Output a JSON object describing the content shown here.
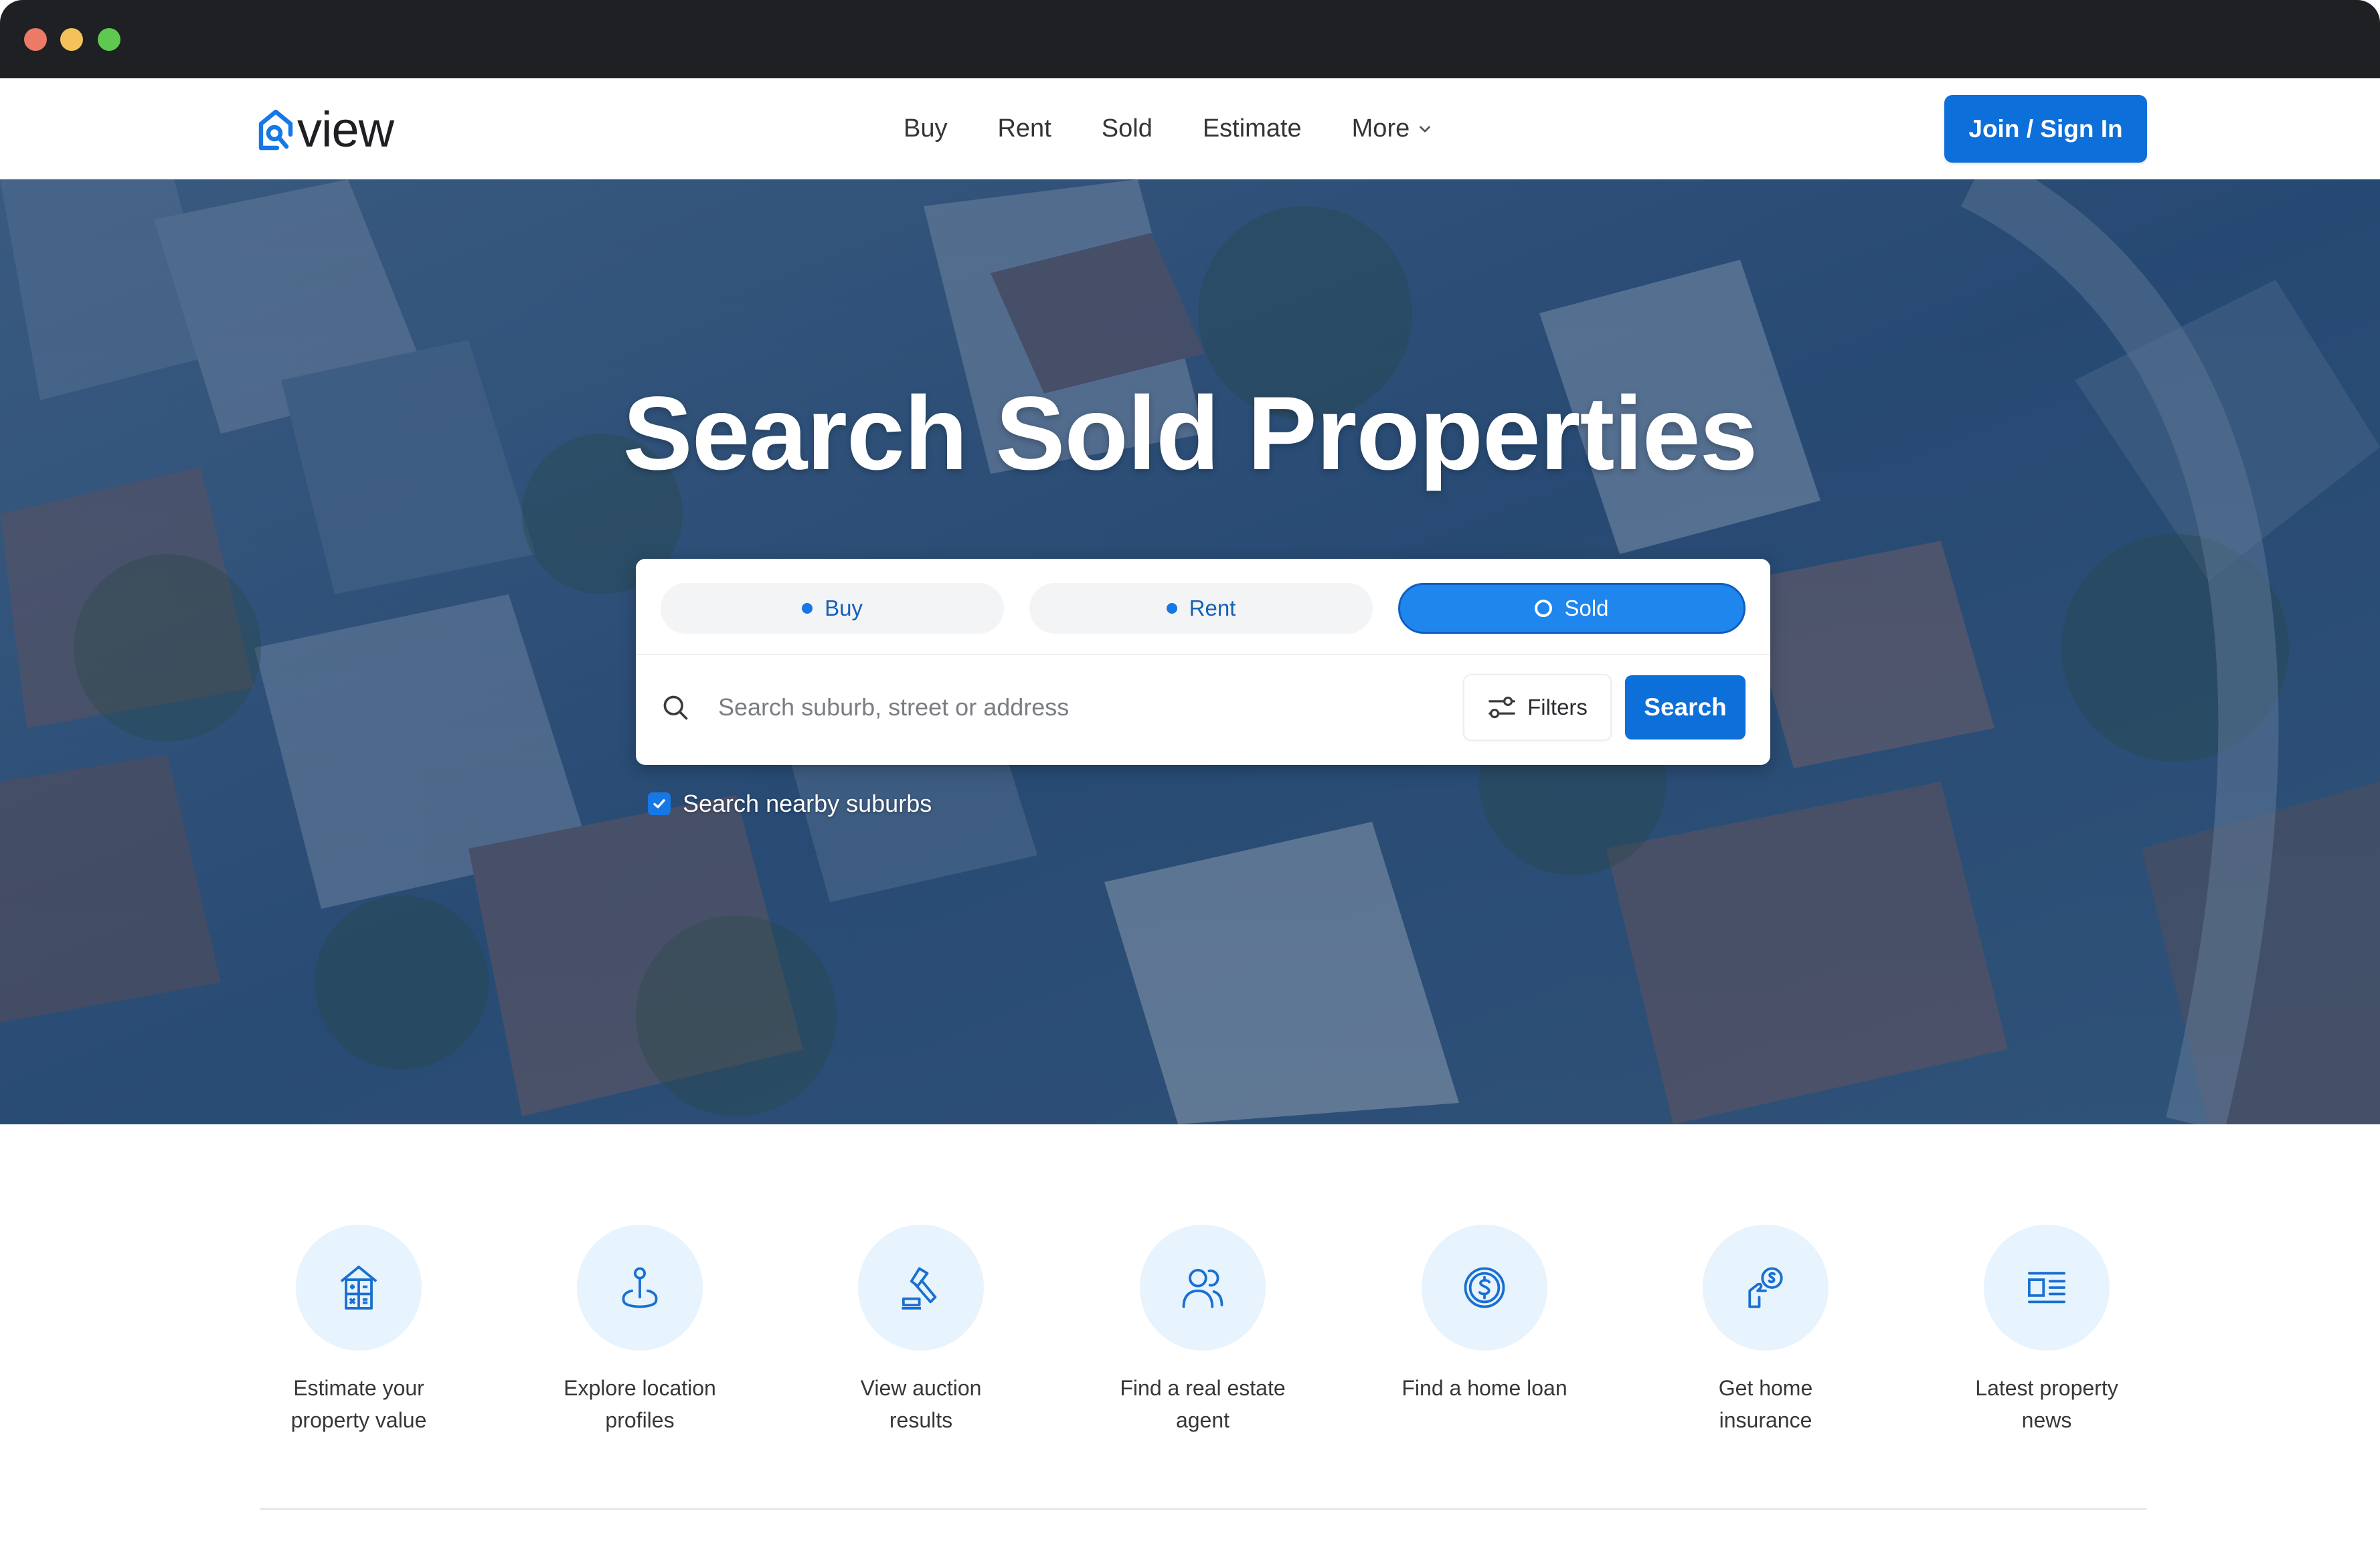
{
  "window": {
    "controls": [
      "close",
      "minimize",
      "maximize"
    ]
  },
  "header": {
    "logo_text": "view",
    "logo_icon": "house-search-icon",
    "nav": [
      {
        "label": "Buy"
      },
      {
        "label": "Rent"
      },
      {
        "label": "Sold"
      },
      {
        "label": "Estimate"
      },
      {
        "label": "More",
        "icon": "chevron-down-icon"
      }
    ],
    "join_label": "Join / Sign In"
  },
  "hero": {
    "title": "Search Sold Properties",
    "tabs": [
      {
        "label": "Buy",
        "active": false
      },
      {
        "label": "Rent",
        "active": false
      },
      {
        "label": "Sold",
        "active": true
      }
    ],
    "search": {
      "placeholder": "Search suburb, street or address",
      "value": "",
      "filters_label": "Filters",
      "search_label": "Search"
    },
    "nearby": {
      "label": "Search nearby suburbs",
      "checked": true
    }
  },
  "services": [
    {
      "label": "Estimate your property value",
      "icon": "house-calculator-icon"
    },
    {
      "label": "Explore location profiles",
      "icon": "location-pin-icon"
    },
    {
      "label": "View auction results",
      "icon": "gavel-icon"
    },
    {
      "label": "Find a real estate agent",
      "icon": "people-icon"
    },
    {
      "label": "Find a home loan",
      "icon": "dollar-coin-icon"
    },
    {
      "label": "Get home insurance",
      "icon": "hand-dollar-icon"
    },
    {
      "label": "Latest property news",
      "icon": "news-icon"
    }
  ],
  "colors": {
    "brand_blue": "#0d6fd9",
    "active_tab": "#1e86ec",
    "icon_circle": "#e7f3fd",
    "chrome": "#1f2023"
  }
}
